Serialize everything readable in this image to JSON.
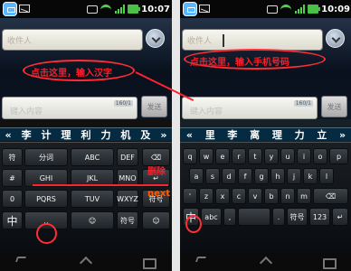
{
  "left_screen": {
    "status_time": "10:07",
    "to_label": "收件人",
    "message_placeholder": "键入内容",
    "counter": "160/1",
    "send_label": "发送",
    "candidates": [
      "«",
      "李",
      "计",
      "理",
      "利",
      "力",
      "机",
      "及",
      "»"
    ],
    "keys": {
      "sym": "符",
      "pinyin_1": "分词",
      "abc": "ABC",
      "def": "DEF",
      "delete": "删除",
      "hash": "#",
      "ghi": "GHI",
      "jkl": "JKL",
      "mno": "MNO",
      "next": "next",
      "pqrs": "PQRS",
      "tuv": "TUV",
      "wxyz": "WXYZ",
      "fuhao": "符号",
      "chinese": "中",
      "space": "␣",
      "emoji": "☺",
      "smile": "☺",
      "zero": "0"
    },
    "annotation": "点击这里，输入汉字",
    "side_labels": {
      "delete": "删除",
      "next": "next"
    }
  },
  "right_screen": {
    "status_time": "10:09",
    "to_label": "收件人",
    "message_placeholder": "键入内容",
    "counter": "160/1",
    "send_label": "发送",
    "candidates": [
      "«",
      "里",
      "李",
      "离",
      "理",
      "力",
      "立",
      "»"
    ],
    "rows": [
      [
        "q",
        "w",
        "e",
        "r",
        "t",
        "y",
        "u",
        "i",
        "o",
        "p"
      ],
      [
        "a",
        "s",
        "d",
        "f",
        "g",
        "h",
        "j",
        "k",
        "l"
      ],
      [
        "'",
        "z",
        "x",
        "c",
        "v",
        "b",
        "n",
        "m",
        "⌫"
      ],
      [
        "中",
        "abc",
        ",",
        " ",
        ".",
        "符号",
        "123",
        "↵"
      ]
    ],
    "annotation": "点击这里，输入手机号码"
  },
  "colors": {
    "annotation": "#fb1f2b",
    "ellipse": "#ff2e36"
  }
}
